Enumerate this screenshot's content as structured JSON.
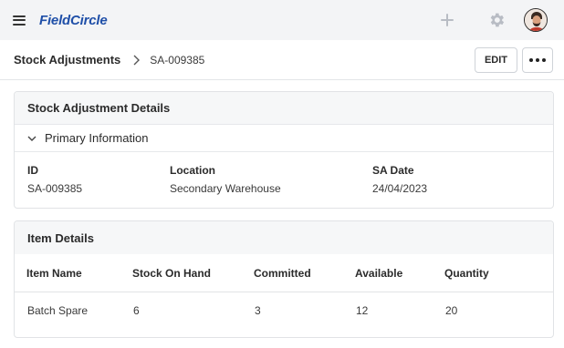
{
  "app": {
    "logo_text": "FieldCircle"
  },
  "header_icons": [
    "hamburger-menu-icon",
    "plus-icon",
    "gear-icon",
    "user-avatar"
  ],
  "breadcrumb": {
    "parent": "Stock Adjustments",
    "current": "SA-009385"
  },
  "actions": {
    "edit_label": "EDIT",
    "more_icon": "more-horizontal-icon"
  },
  "details_card": {
    "title": "Stock Adjustment Details",
    "section_label": "Primary Information",
    "fields": [
      {
        "label": "ID",
        "value": "SA-009385"
      },
      {
        "label": "Location",
        "value": "Secondary Warehouse"
      },
      {
        "label": "SA Date",
        "value": "24/04/2023"
      }
    ]
  },
  "items_card": {
    "title": "Item Details",
    "columns": [
      "Item Name",
      "Stock On Hand",
      "Committed",
      "Available",
      "Quantity"
    ],
    "rows": [
      [
        "Batch Spare",
        "6",
        "3",
        "12",
        "20"
      ]
    ]
  },
  "colors": {
    "brand": "#1f4fa8",
    "header_bg": "#f3f4f6",
    "border": "#e1e3e6"
  }
}
